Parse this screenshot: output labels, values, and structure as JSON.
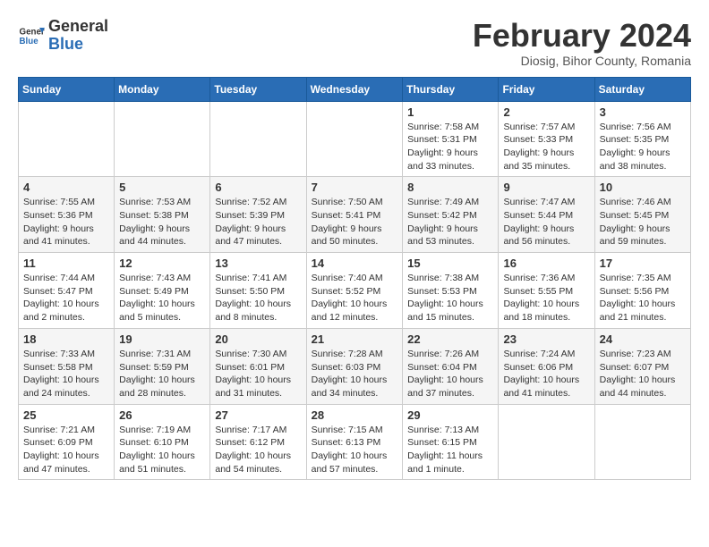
{
  "header": {
    "logo_general": "General",
    "logo_blue": "Blue",
    "title": "February 2024",
    "subtitle": "Diosig, Bihor County, Romania"
  },
  "calendar": {
    "weekdays": [
      "Sunday",
      "Monday",
      "Tuesday",
      "Wednesday",
      "Thursday",
      "Friday",
      "Saturday"
    ],
    "weeks": [
      [
        {
          "day": "",
          "info": ""
        },
        {
          "day": "",
          "info": ""
        },
        {
          "day": "",
          "info": ""
        },
        {
          "day": "",
          "info": ""
        },
        {
          "day": "1",
          "info": "Sunrise: 7:58 AM\nSunset: 5:31 PM\nDaylight: 9 hours\nand 33 minutes."
        },
        {
          "day": "2",
          "info": "Sunrise: 7:57 AM\nSunset: 5:33 PM\nDaylight: 9 hours\nand 35 minutes."
        },
        {
          "day": "3",
          "info": "Sunrise: 7:56 AM\nSunset: 5:35 PM\nDaylight: 9 hours\nand 38 minutes."
        }
      ],
      [
        {
          "day": "4",
          "info": "Sunrise: 7:55 AM\nSunset: 5:36 PM\nDaylight: 9 hours\nand 41 minutes."
        },
        {
          "day": "5",
          "info": "Sunrise: 7:53 AM\nSunset: 5:38 PM\nDaylight: 9 hours\nand 44 minutes."
        },
        {
          "day": "6",
          "info": "Sunrise: 7:52 AM\nSunset: 5:39 PM\nDaylight: 9 hours\nand 47 minutes."
        },
        {
          "day": "7",
          "info": "Sunrise: 7:50 AM\nSunset: 5:41 PM\nDaylight: 9 hours\nand 50 minutes."
        },
        {
          "day": "8",
          "info": "Sunrise: 7:49 AM\nSunset: 5:42 PM\nDaylight: 9 hours\nand 53 minutes."
        },
        {
          "day": "9",
          "info": "Sunrise: 7:47 AM\nSunset: 5:44 PM\nDaylight: 9 hours\nand 56 minutes."
        },
        {
          "day": "10",
          "info": "Sunrise: 7:46 AM\nSunset: 5:45 PM\nDaylight: 9 hours\nand 59 minutes."
        }
      ],
      [
        {
          "day": "11",
          "info": "Sunrise: 7:44 AM\nSunset: 5:47 PM\nDaylight: 10 hours\nand 2 minutes."
        },
        {
          "day": "12",
          "info": "Sunrise: 7:43 AM\nSunset: 5:49 PM\nDaylight: 10 hours\nand 5 minutes."
        },
        {
          "day": "13",
          "info": "Sunrise: 7:41 AM\nSunset: 5:50 PM\nDaylight: 10 hours\nand 8 minutes."
        },
        {
          "day": "14",
          "info": "Sunrise: 7:40 AM\nSunset: 5:52 PM\nDaylight: 10 hours\nand 12 minutes."
        },
        {
          "day": "15",
          "info": "Sunrise: 7:38 AM\nSunset: 5:53 PM\nDaylight: 10 hours\nand 15 minutes."
        },
        {
          "day": "16",
          "info": "Sunrise: 7:36 AM\nSunset: 5:55 PM\nDaylight: 10 hours\nand 18 minutes."
        },
        {
          "day": "17",
          "info": "Sunrise: 7:35 AM\nSunset: 5:56 PM\nDaylight: 10 hours\nand 21 minutes."
        }
      ],
      [
        {
          "day": "18",
          "info": "Sunrise: 7:33 AM\nSunset: 5:58 PM\nDaylight: 10 hours\nand 24 minutes."
        },
        {
          "day": "19",
          "info": "Sunrise: 7:31 AM\nSunset: 5:59 PM\nDaylight: 10 hours\nand 28 minutes."
        },
        {
          "day": "20",
          "info": "Sunrise: 7:30 AM\nSunset: 6:01 PM\nDaylight: 10 hours\nand 31 minutes."
        },
        {
          "day": "21",
          "info": "Sunrise: 7:28 AM\nSunset: 6:03 PM\nDaylight: 10 hours\nand 34 minutes."
        },
        {
          "day": "22",
          "info": "Sunrise: 7:26 AM\nSunset: 6:04 PM\nDaylight: 10 hours\nand 37 minutes."
        },
        {
          "day": "23",
          "info": "Sunrise: 7:24 AM\nSunset: 6:06 PM\nDaylight: 10 hours\nand 41 minutes."
        },
        {
          "day": "24",
          "info": "Sunrise: 7:23 AM\nSunset: 6:07 PM\nDaylight: 10 hours\nand 44 minutes."
        }
      ],
      [
        {
          "day": "25",
          "info": "Sunrise: 7:21 AM\nSunset: 6:09 PM\nDaylight: 10 hours\nand 47 minutes."
        },
        {
          "day": "26",
          "info": "Sunrise: 7:19 AM\nSunset: 6:10 PM\nDaylight: 10 hours\nand 51 minutes."
        },
        {
          "day": "27",
          "info": "Sunrise: 7:17 AM\nSunset: 6:12 PM\nDaylight: 10 hours\nand 54 minutes."
        },
        {
          "day": "28",
          "info": "Sunrise: 7:15 AM\nSunset: 6:13 PM\nDaylight: 10 hours\nand 57 minutes."
        },
        {
          "day": "29",
          "info": "Sunrise: 7:13 AM\nSunset: 6:15 PM\nDaylight: 11 hours\nand 1 minute."
        },
        {
          "day": "",
          "info": ""
        },
        {
          "day": "",
          "info": ""
        }
      ]
    ]
  }
}
